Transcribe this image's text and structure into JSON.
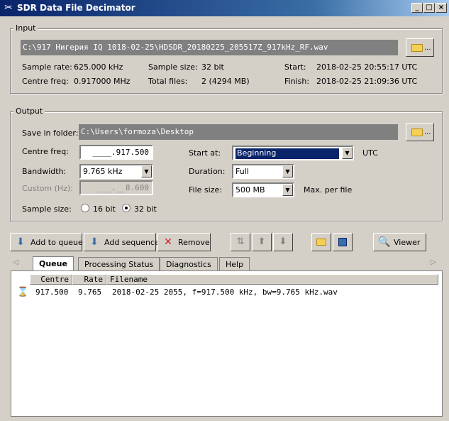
{
  "window": {
    "title": "SDR Data File Decimator"
  },
  "input": {
    "group_label": "Input",
    "path": "C:\\917 Нигерия IQ 1018-02-25\\HDSDR_20180225_205517Z_917kHz_RF.wav",
    "folder_btn_dots": "...",
    "sample_rate_label": "Sample rate:",
    "sample_rate": "625.000 kHz",
    "sample_size_label": "Sample size:",
    "sample_size": "32 bit",
    "start_label": "Start:",
    "start": "2018-02-25 20:55:17 UTC",
    "centre_freq_label": "Centre freq:",
    "centre_freq": "0.917000 MHz",
    "total_files_label": "Total files:",
    "total_files": "2 (4294 MB)",
    "finish_label": "Finish:",
    "finish": "2018-02-25 21:09:36 UTC"
  },
  "output": {
    "group_label": "Output",
    "save_label": "Save in folder:",
    "save_path": "C:\\Users\\formoza\\Desktop",
    "folder_btn_dots": "...",
    "centre_freq_label": "Centre freq:",
    "centre_freq": "____.917.500",
    "bandwidth_label": "Bandwidth:",
    "bandwidth": "9.765 kHz",
    "custom_label": "Custom (Hz):",
    "custom": "___.__8.600",
    "sample_size_label": "Sample size:",
    "radio_16": "16 bit",
    "radio_32": "32 bit",
    "start_at_label": "Start at:",
    "start_at": "Beginning",
    "start_at_unit": "UTC",
    "duration_label": "Duration:",
    "duration": "Full",
    "file_size_label": "File size:",
    "file_size": "500 MB",
    "file_size_note": "Max. per file"
  },
  "toolbar": {
    "add_queue": "Add to queue",
    "add_sequence": "Add sequence",
    "remove": "Remove",
    "viewer": "Viewer"
  },
  "tabs": [
    "Queue",
    "Processing Status",
    "Diagnostics",
    "Help"
  ],
  "queue": {
    "headers": {
      "centre": "Centre",
      "rate": "Rate",
      "filename": "Filename"
    },
    "rows": [
      {
        "centre": "917.500",
        "rate": "9.765",
        "filename": "2018-02-25 2055, f=917.500 kHz, bw=9.765 kHz.wav"
      }
    ]
  },
  "colors": {
    "titlebar": "#0a246a",
    "selection": "#0a246a",
    "face": "#d4d0c8"
  }
}
